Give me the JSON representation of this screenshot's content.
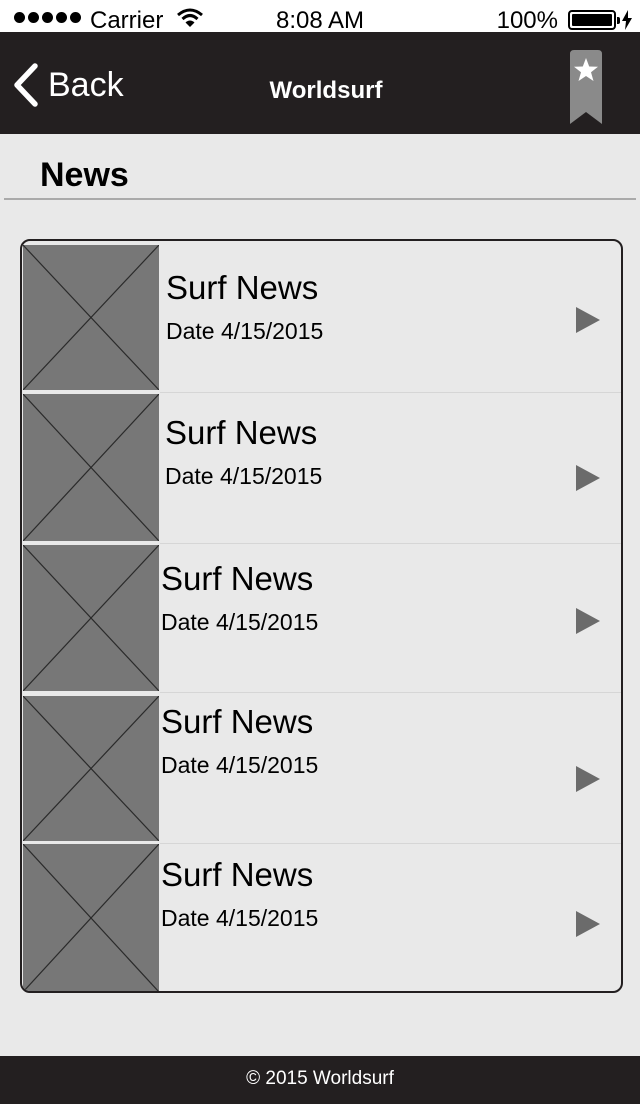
{
  "status_bar": {
    "carrier": "Carrier",
    "time": "8:08 AM",
    "battery": "100%"
  },
  "nav": {
    "back_label": "Back",
    "title": "Worldsurf",
    "bookmark_icon": "bookmark-star-icon"
  },
  "section": {
    "title": "News"
  },
  "news_items": [
    {
      "title": "Surf News",
      "date": "Date 4/15/2015"
    },
    {
      "title": "Surf News",
      "date": "Date 4/15/2015"
    },
    {
      "title": "Surf News",
      "date": "Date 4/15/2015"
    },
    {
      "title": "Surf News",
      "date": "Date 4/15/2015"
    },
    {
      "title": "Surf News",
      "date": "Date 4/15/2015"
    }
  ],
  "footer": {
    "copyright": "© 2015 Worldsurf"
  },
  "colors": {
    "bar_background": "#231f20",
    "screen_background": "#e9e9e9",
    "thumbnail_placeholder": "#777777",
    "chevron_arrow": "#6b6b6b"
  }
}
